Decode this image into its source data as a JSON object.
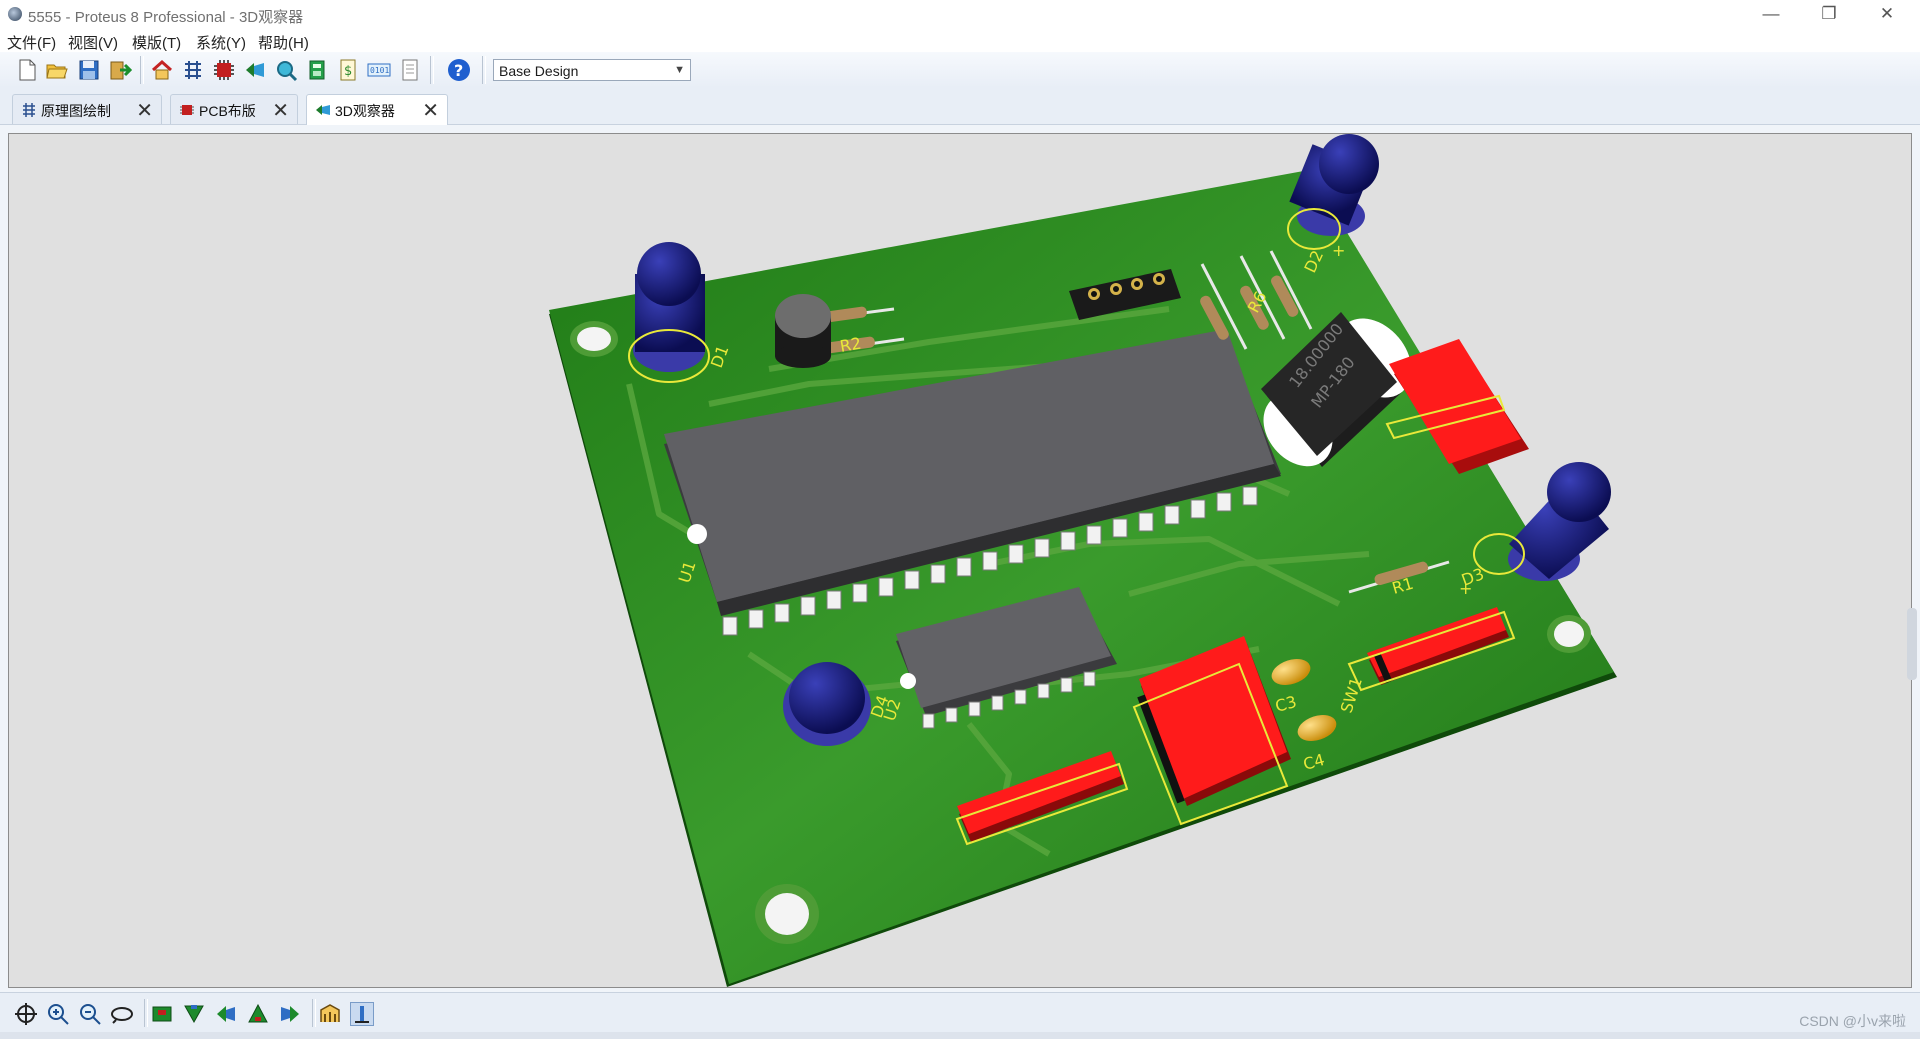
{
  "window": {
    "title": "5555 - Proteus 8 Professional - 3D观察器",
    "minimize": "—",
    "restore": "❐",
    "close": "✕"
  },
  "menu": [
    "文件(F)",
    "视图(V)",
    "模版(T)",
    "系统(Y)",
    "帮助(H)"
  ],
  "toolbar": {
    "design_select": "Base Design"
  },
  "tabs": [
    {
      "label": "原理图绘制",
      "icon": "schematic-icon",
      "active": false
    },
    {
      "label": "PCB布版",
      "icon": "pcb-layout-icon",
      "active": false
    },
    {
      "label": "3D观察器",
      "icon": "3d-viewer-icon",
      "active": true
    }
  ],
  "tab_close_glyph": "✕",
  "board": {
    "silkscreen": {
      "D1": "D1",
      "D2": "D2",
      "D3": "D3",
      "D4": "D4",
      "R1": "R1",
      "R2": "R2",
      "R6": "R6",
      "U1": "U1",
      "U2": "U2",
      "C3": "C3",
      "C4": "C4",
      "SW": "SW1",
      "plus_d2": "+",
      "plus_d3": "+"
    },
    "crystal_text_1": "18.00000",
    "crystal_text_2": "MP-180",
    "colors": {
      "pcb": "#2f8a22",
      "chip": "#5f5f63",
      "led": "#14186e",
      "red_part": "#ff1616",
      "silkscreen": "#e9e93a"
    }
  },
  "watermark": "CSDN @小v来啦"
}
